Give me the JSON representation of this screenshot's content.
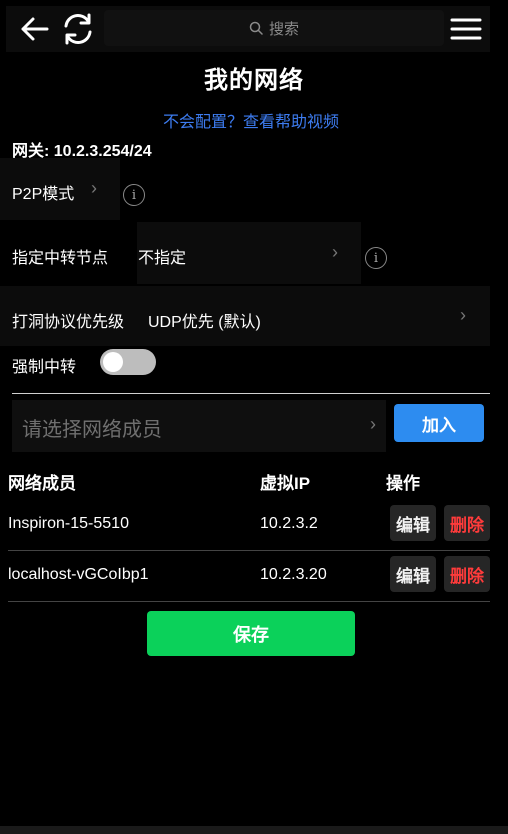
{
  "header": {
    "search_placeholder": "搜索"
  },
  "page": {
    "title": "我的网络",
    "help_link": "不会配置？查看帮助视频",
    "gateway": "网关: 10.2.3.254/24"
  },
  "settings": {
    "p2p_label": "P2P模式",
    "relay_label": "指定中转节点",
    "relay_value": "不指定",
    "holepunch_label": "打洞协议优先级",
    "holepunch_value": "UDP优先 (默认)",
    "force_relay_label": "强制中转",
    "force_relay_on": false
  },
  "members": {
    "select_placeholder": "请选择网络成员",
    "join_label": "加入",
    "columns": [
      "网络成员",
      "虚拟IP",
      "操作"
    ],
    "rows": [
      {
        "name": "Inspiron-15-5510",
        "ip": "10.2.3.2",
        "edit": "编辑",
        "delete": "删除"
      },
      {
        "name": "localhost-vGCoIbp1",
        "ip": "10.2.3.20",
        "edit": "编辑",
        "delete": "删除"
      }
    ]
  },
  "actions": {
    "save_label": "保存"
  },
  "icons": {
    "back": "arrow-left-icon",
    "refresh": "refresh-icon",
    "search": "search-icon",
    "menu": "hamburger-menu-icon",
    "info": "info-circle-icon",
    "chevron": "chevron-right-icon"
  },
  "colors": {
    "link": "#3d7cf0",
    "join": "#2d8cf0",
    "save": "#0bd15a",
    "delete": "#ff3b3b"
  }
}
